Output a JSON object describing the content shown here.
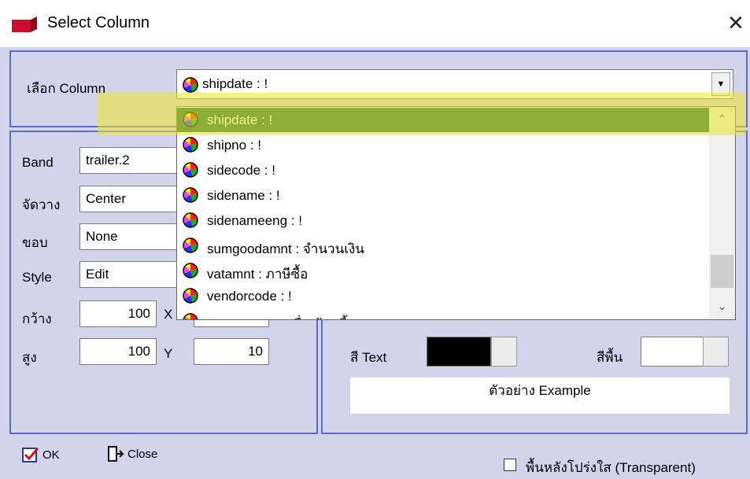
{
  "window": {
    "title": "Select Column",
    "close_symbol": "✕"
  },
  "column_select": {
    "label": "เลือก Column",
    "value": "shipdate : !",
    "dropdown_arrow": "▼",
    "options": [
      "shipdate : !",
      "shipno : !",
      "sidecode : !",
      "sidename : !",
      "sidenameeng : !",
      "sumgoodamnt : จำนวนเงิน",
      "vatamnt : ภาษีซื้อ",
      "vendorcode : !",
      "vendorname : ชื่อเจ้าหนี้"
    ],
    "selected_index": 0,
    "scroll_up": "⌃",
    "scroll_down": "⌄"
  },
  "properties": {
    "band": {
      "label": "Band",
      "value": "trailer.2"
    },
    "align": {
      "label": "จัดวาง",
      "value": "Center"
    },
    "border": {
      "label": "ขอบ",
      "value": "None"
    },
    "style": {
      "label": "Style",
      "value": "Edit"
    },
    "width": {
      "label": "กว้าง",
      "value": "100"
    },
    "height": {
      "label": "สูง",
      "value": "100"
    },
    "x": {
      "label": "X",
      "value": ""
    },
    "y": {
      "label": "Y",
      "value": "10"
    }
  },
  "colors": {
    "text_label": "สี Text",
    "text_color": "#000000",
    "bg_label": "สีพื้น",
    "bg_color": "#ffffff",
    "selection_color": "#1a6a48",
    "frame_color": "#5b6cc8"
  },
  "example_text": "ตัวอย่าง Example",
  "buttons": {
    "ok": "OK",
    "close": "Close"
  },
  "transparent": {
    "label": "พื้นหลังโปร่งใส (Transparent)",
    "checked": false
  }
}
